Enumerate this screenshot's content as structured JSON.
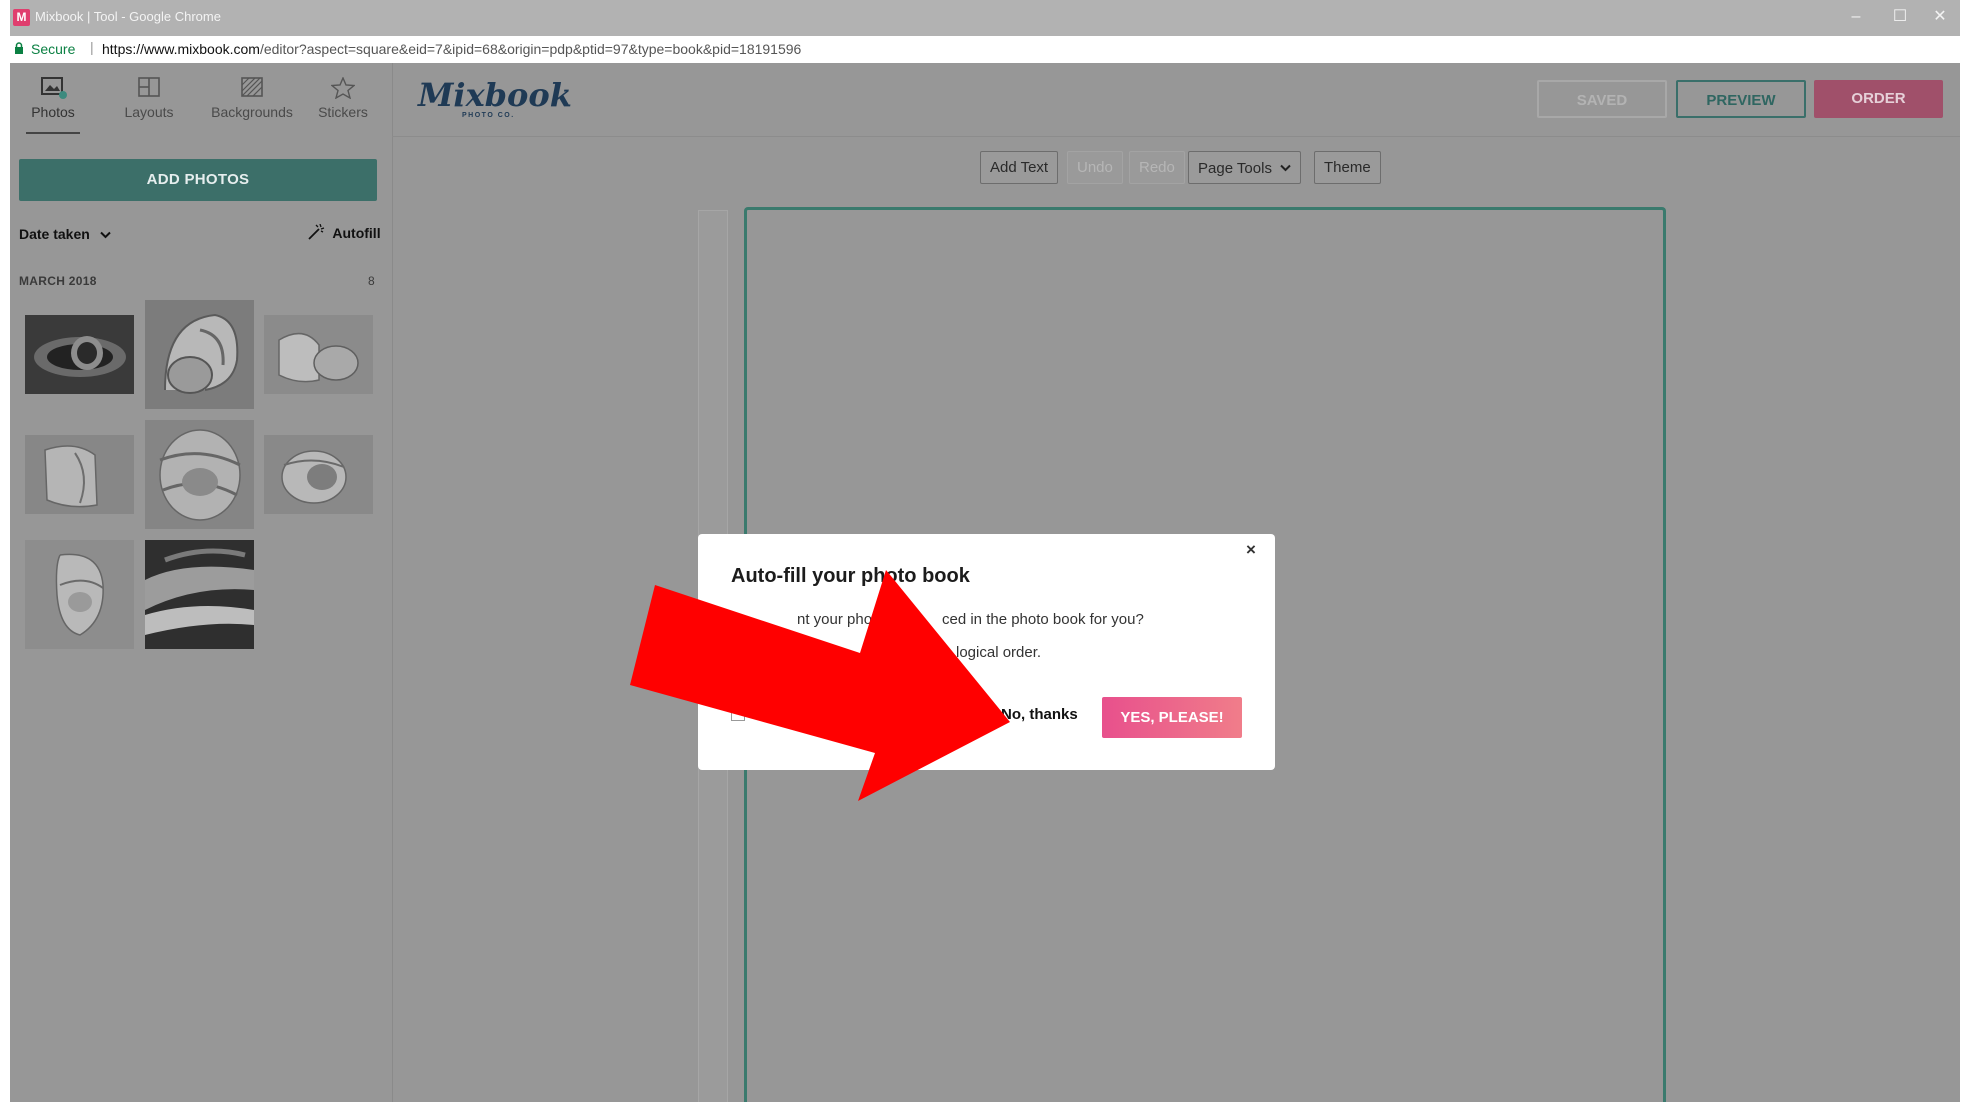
{
  "browser": {
    "window_title": "Mixbook | Tool - Google Chrome",
    "secure_label": "Secure",
    "url_host": "https://www.mixbook.com",
    "url_path": "/editor?aspect=square&eid=7&ipid=68&origin=pdp&ptid=97&type=book&pid=18191596"
  },
  "sidebar": {
    "tabs": [
      {
        "label": "Photos",
        "icon": "photos-icon",
        "badge": "8"
      },
      {
        "label": "Layouts",
        "icon": "layouts-icon"
      },
      {
        "label": "Backgrounds",
        "icon": "backgrounds-icon"
      },
      {
        "label": "Stickers",
        "icon": "star-icon"
      }
    ],
    "add_photos_label": "ADD PHOTOS",
    "sort_label": "Date taken",
    "autofill_label": "Autofill",
    "group_label": "MARCH 2018",
    "group_count": "8"
  },
  "header": {
    "logo_text": "Mixbook",
    "logo_sub": "PHOTO CO.",
    "saved_label": "SAVED",
    "preview_label": "PREVIEW",
    "order_label": "ORDER"
  },
  "toolbar": {
    "add_text": "Add Text",
    "undo": "Undo",
    "redo": "Redo",
    "page_tools": "Page Tools",
    "theme": "Theme"
  },
  "modal": {
    "close_glyph": "×",
    "title": "Auto-fill your photo book",
    "line1_a": "nt your photos",
    "line1_b": "ced in the photo book for you?",
    "line2": "logical order.",
    "no_label": "No, thanks",
    "yes_label": "YES, PLEASE!"
  },
  "colors": {
    "accent_teal": "#3c6f69",
    "order_pink": "#a0506a",
    "yes_gradient_start": "#e8508c",
    "yes_gradient_end": "#f07d8a",
    "annotation_arrow": "#ff0000"
  }
}
